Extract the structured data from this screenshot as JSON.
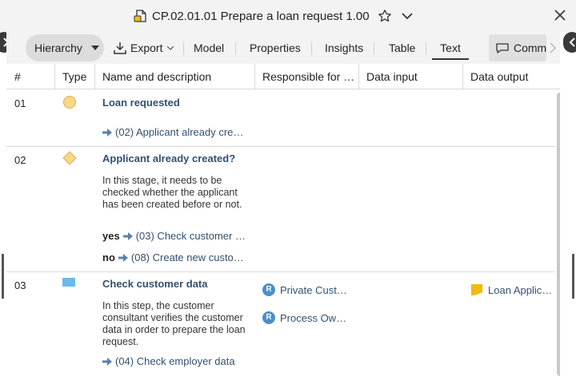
{
  "window": {
    "title": "CP.02.01.01 Prepare a loan request 1.00",
    "icons": [
      "document-icon",
      "star-icon",
      "chevron-down-icon",
      "close-icon"
    ]
  },
  "toolbar": {
    "hierarchy": "Hierarchy",
    "export": "Export",
    "model": "Model",
    "properties": "Properties",
    "insights": "Insights",
    "table": "Table",
    "text": "Text",
    "comments": "Comments"
  },
  "columns": {
    "num": "#",
    "type": "Type",
    "name": "Name and description",
    "responsible": "Responsible for …",
    "input": "Data input",
    "output": "Data output"
  },
  "rows": [
    {
      "num": "01",
      "type": "start-event",
      "name": "Loan requested",
      "links": [
        {
          "label": "",
          "text": "(02) Applicant already cre…"
        }
      ]
    },
    {
      "num": "02",
      "type": "decision",
      "name": "Applicant already created?",
      "description": "In this stage, it needs to be checked whether the applicant has been created before or not.",
      "links": [
        {
          "label": "yes",
          "text": "(03) Check customer …"
        },
        {
          "label": "no",
          "text": "(08) Create new custo…"
        }
      ]
    },
    {
      "num": "03",
      "type": "task",
      "name": "Check customer data",
      "description": "In this step, the customer consultant verifies the customer data in order to prepare the loan request.",
      "links": [
        {
          "label": "",
          "text": "(04) Check employer data"
        }
      ],
      "responsible": [
        {
          "badge": "R",
          "text": "Private Cust…"
        },
        {
          "badge": "R",
          "text": "Process Ow…"
        }
      ],
      "output": [
        {
          "text": "Loan Applic…"
        }
      ]
    }
  ],
  "colors": {
    "link": "#33506e",
    "event": "#f7d886",
    "task": "#6cb9ec",
    "badge": "#4a8fc7",
    "doc": "#f2b90f"
  }
}
